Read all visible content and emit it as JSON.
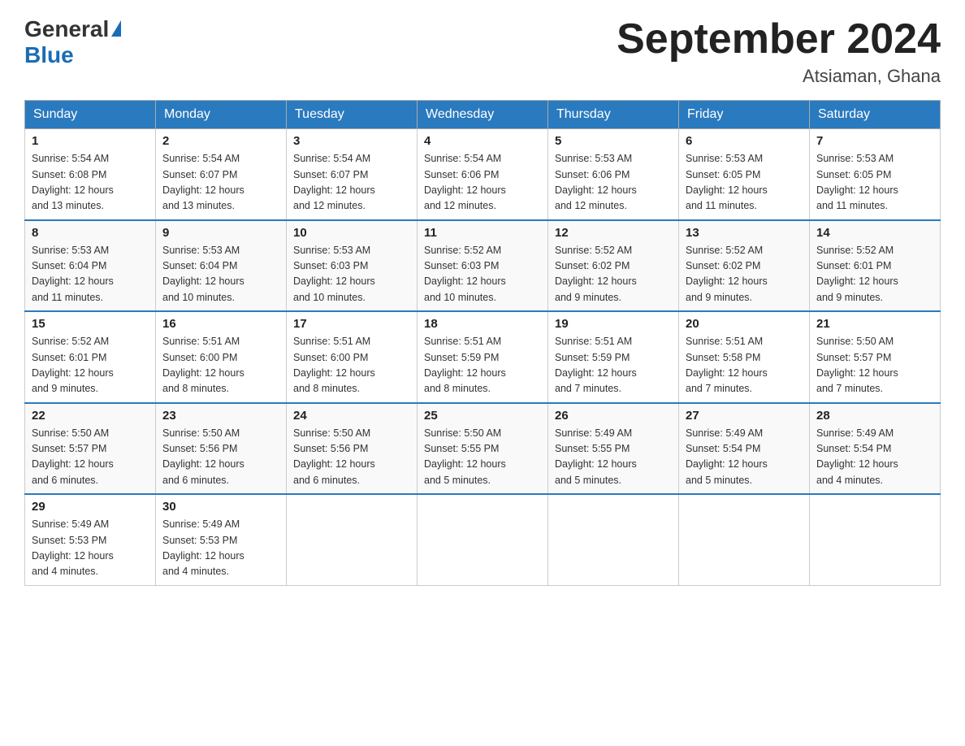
{
  "header": {
    "logo_general": "General",
    "logo_blue": "Blue",
    "month_title": "September 2024",
    "location": "Atsiaman, Ghana"
  },
  "weekdays": [
    "Sunday",
    "Monday",
    "Tuesday",
    "Wednesday",
    "Thursday",
    "Friday",
    "Saturday"
  ],
  "weeks": [
    [
      {
        "day": "1",
        "sunrise": "5:54 AM",
        "sunset": "6:08 PM",
        "daylight": "12 hours and 13 minutes."
      },
      {
        "day": "2",
        "sunrise": "5:54 AM",
        "sunset": "6:07 PM",
        "daylight": "12 hours and 13 minutes."
      },
      {
        "day": "3",
        "sunrise": "5:54 AM",
        "sunset": "6:07 PM",
        "daylight": "12 hours and 12 minutes."
      },
      {
        "day": "4",
        "sunrise": "5:54 AM",
        "sunset": "6:06 PM",
        "daylight": "12 hours and 12 minutes."
      },
      {
        "day": "5",
        "sunrise": "5:53 AM",
        "sunset": "6:06 PM",
        "daylight": "12 hours and 12 minutes."
      },
      {
        "day": "6",
        "sunrise": "5:53 AM",
        "sunset": "6:05 PM",
        "daylight": "12 hours and 11 minutes."
      },
      {
        "day": "7",
        "sunrise": "5:53 AM",
        "sunset": "6:05 PM",
        "daylight": "12 hours and 11 minutes."
      }
    ],
    [
      {
        "day": "8",
        "sunrise": "5:53 AM",
        "sunset": "6:04 PM",
        "daylight": "12 hours and 11 minutes."
      },
      {
        "day": "9",
        "sunrise": "5:53 AM",
        "sunset": "6:04 PM",
        "daylight": "12 hours and 10 minutes."
      },
      {
        "day": "10",
        "sunrise": "5:53 AM",
        "sunset": "6:03 PM",
        "daylight": "12 hours and 10 minutes."
      },
      {
        "day": "11",
        "sunrise": "5:52 AM",
        "sunset": "6:03 PM",
        "daylight": "12 hours and 10 minutes."
      },
      {
        "day": "12",
        "sunrise": "5:52 AM",
        "sunset": "6:02 PM",
        "daylight": "12 hours and 9 minutes."
      },
      {
        "day": "13",
        "sunrise": "5:52 AM",
        "sunset": "6:02 PM",
        "daylight": "12 hours and 9 minutes."
      },
      {
        "day": "14",
        "sunrise": "5:52 AM",
        "sunset": "6:01 PM",
        "daylight": "12 hours and 9 minutes."
      }
    ],
    [
      {
        "day": "15",
        "sunrise": "5:52 AM",
        "sunset": "6:01 PM",
        "daylight": "12 hours and 9 minutes."
      },
      {
        "day": "16",
        "sunrise": "5:51 AM",
        "sunset": "6:00 PM",
        "daylight": "12 hours and 8 minutes."
      },
      {
        "day": "17",
        "sunrise": "5:51 AM",
        "sunset": "6:00 PM",
        "daylight": "12 hours and 8 minutes."
      },
      {
        "day": "18",
        "sunrise": "5:51 AM",
        "sunset": "5:59 PM",
        "daylight": "12 hours and 8 minutes."
      },
      {
        "day": "19",
        "sunrise": "5:51 AM",
        "sunset": "5:59 PM",
        "daylight": "12 hours and 7 minutes."
      },
      {
        "day": "20",
        "sunrise": "5:51 AM",
        "sunset": "5:58 PM",
        "daylight": "12 hours and 7 minutes."
      },
      {
        "day": "21",
        "sunrise": "5:50 AM",
        "sunset": "5:57 PM",
        "daylight": "12 hours and 7 minutes."
      }
    ],
    [
      {
        "day": "22",
        "sunrise": "5:50 AM",
        "sunset": "5:57 PM",
        "daylight": "12 hours and 6 minutes."
      },
      {
        "day": "23",
        "sunrise": "5:50 AM",
        "sunset": "5:56 PM",
        "daylight": "12 hours and 6 minutes."
      },
      {
        "day": "24",
        "sunrise": "5:50 AM",
        "sunset": "5:56 PM",
        "daylight": "12 hours and 6 minutes."
      },
      {
        "day": "25",
        "sunrise": "5:50 AM",
        "sunset": "5:55 PM",
        "daylight": "12 hours and 5 minutes."
      },
      {
        "day": "26",
        "sunrise": "5:49 AM",
        "sunset": "5:55 PM",
        "daylight": "12 hours and 5 minutes."
      },
      {
        "day": "27",
        "sunrise": "5:49 AM",
        "sunset": "5:54 PM",
        "daylight": "12 hours and 5 minutes."
      },
      {
        "day": "28",
        "sunrise": "5:49 AM",
        "sunset": "5:54 PM",
        "daylight": "12 hours and 4 minutes."
      }
    ],
    [
      {
        "day": "29",
        "sunrise": "5:49 AM",
        "sunset": "5:53 PM",
        "daylight": "12 hours and 4 minutes."
      },
      {
        "day": "30",
        "sunrise": "5:49 AM",
        "sunset": "5:53 PM",
        "daylight": "12 hours and 4 minutes."
      },
      {
        "day": "",
        "sunrise": "",
        "sunset": "",
        "daylight": ""
      },
      {
        "day": "",
        "sunrise": "",
        "sunset": "",
        "daylight": ""
      },
      {
        "day": "",
        "sunrise": "",
        "sunset": "",
        "daylight": ""
      },
      {
        "day": "",
        "sunrise": "",
        "sunset": "",
        "daylight": ""
      },
      {
        "day": "",
        "sunrise": "",
        "sunset": "",
        "daylight": ""
      }
    ]
  ],
  "labels": {
    "sunrise": "Sunrise:",
    "sunset": "Sunset:",
    "daylight": "Daylight:"
  }
}
